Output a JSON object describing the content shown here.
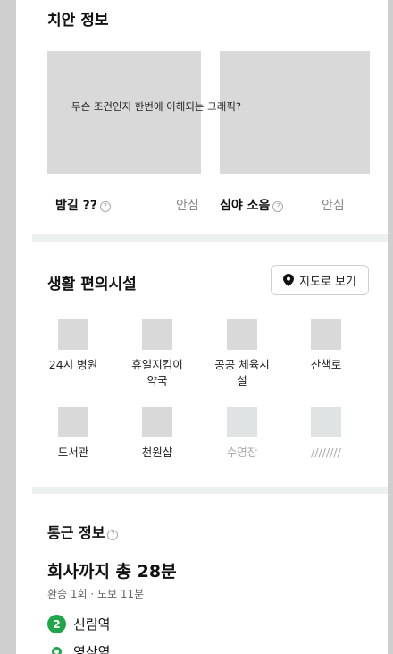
{
  "safety": {
    "title": "치안 정보",
    "graphic_caption": "무슨 조건인지 한번에 이해되는 그래픽?",
    "night_road_label": "밤길 ??",
    "night_road_value": "안심",
    "late_noise_label": "심야 소음",
    "late_noise_value": "안심",
    "help_glyph": "?"
  },
  "facilities": {
    "title": "생활 편의시설",
    "map_button_label": "지도로 보기",
    "items": [
      {
        "label": "24시 병원"
      },
      {
        "label": "휴일지킴이\n약국"
      },
      {
        "label": "공공 체육시\n설"
      },
      {
        "label": "산책로"
      },
      {
        "label": "도서관"
      },
      {
        "label": "천원샵"
      },
      {
        "label": "수영장"
      },
      {
        "label": "////////"
      }
    ]
  },
  "commute": {
    "title": "통근 정보",
    "total": "회사까지 총 28분",
    "summary": "환승 1회 · 도보 11분",
    "line_number": "2",
    "stations": [
      "신림역",
      "영삼역"
    ]
  },
  "colors": {
    "subway_line_2": "#1fa64a",
    "placeholder": "#d9d9d9",
    "divider": "#eef0f0"
  }
}
